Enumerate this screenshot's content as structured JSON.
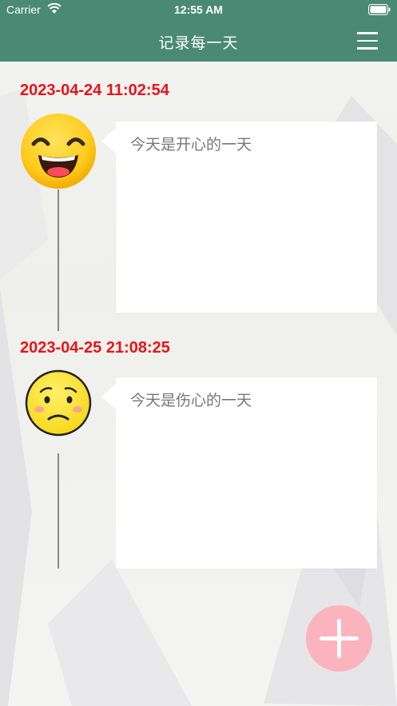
{
  "status_bar": {
    "carrier": "Carrier",
    "time": "12:55 AM"
  },
  "nav": {
    "title": "记录每一天",
    "menu_icon": "hamburger-menu-icon"
  },
  "entries": [
    {
      "date": "2023-04-24 11:02:54",
      "mood": "happy",
      "mood_icon": "happy-face-icon",
      "text": "今天是开心的一天"
    },
    {
      "date": "2023-04-25 21:08:25",
      "mood": "sad",
      "mood_icon": "sad-face-icon",
      "text": "今天是伤心的一天"
    }
  ],
  "add_button": {
    "icon": "plus-icon",
    "color": "#fbb4bd"
  },
  "colors": {
    "nav": "#4a8a74",
    "date": "#e8141a",
    "entry_text": "#777777"
  }
}
